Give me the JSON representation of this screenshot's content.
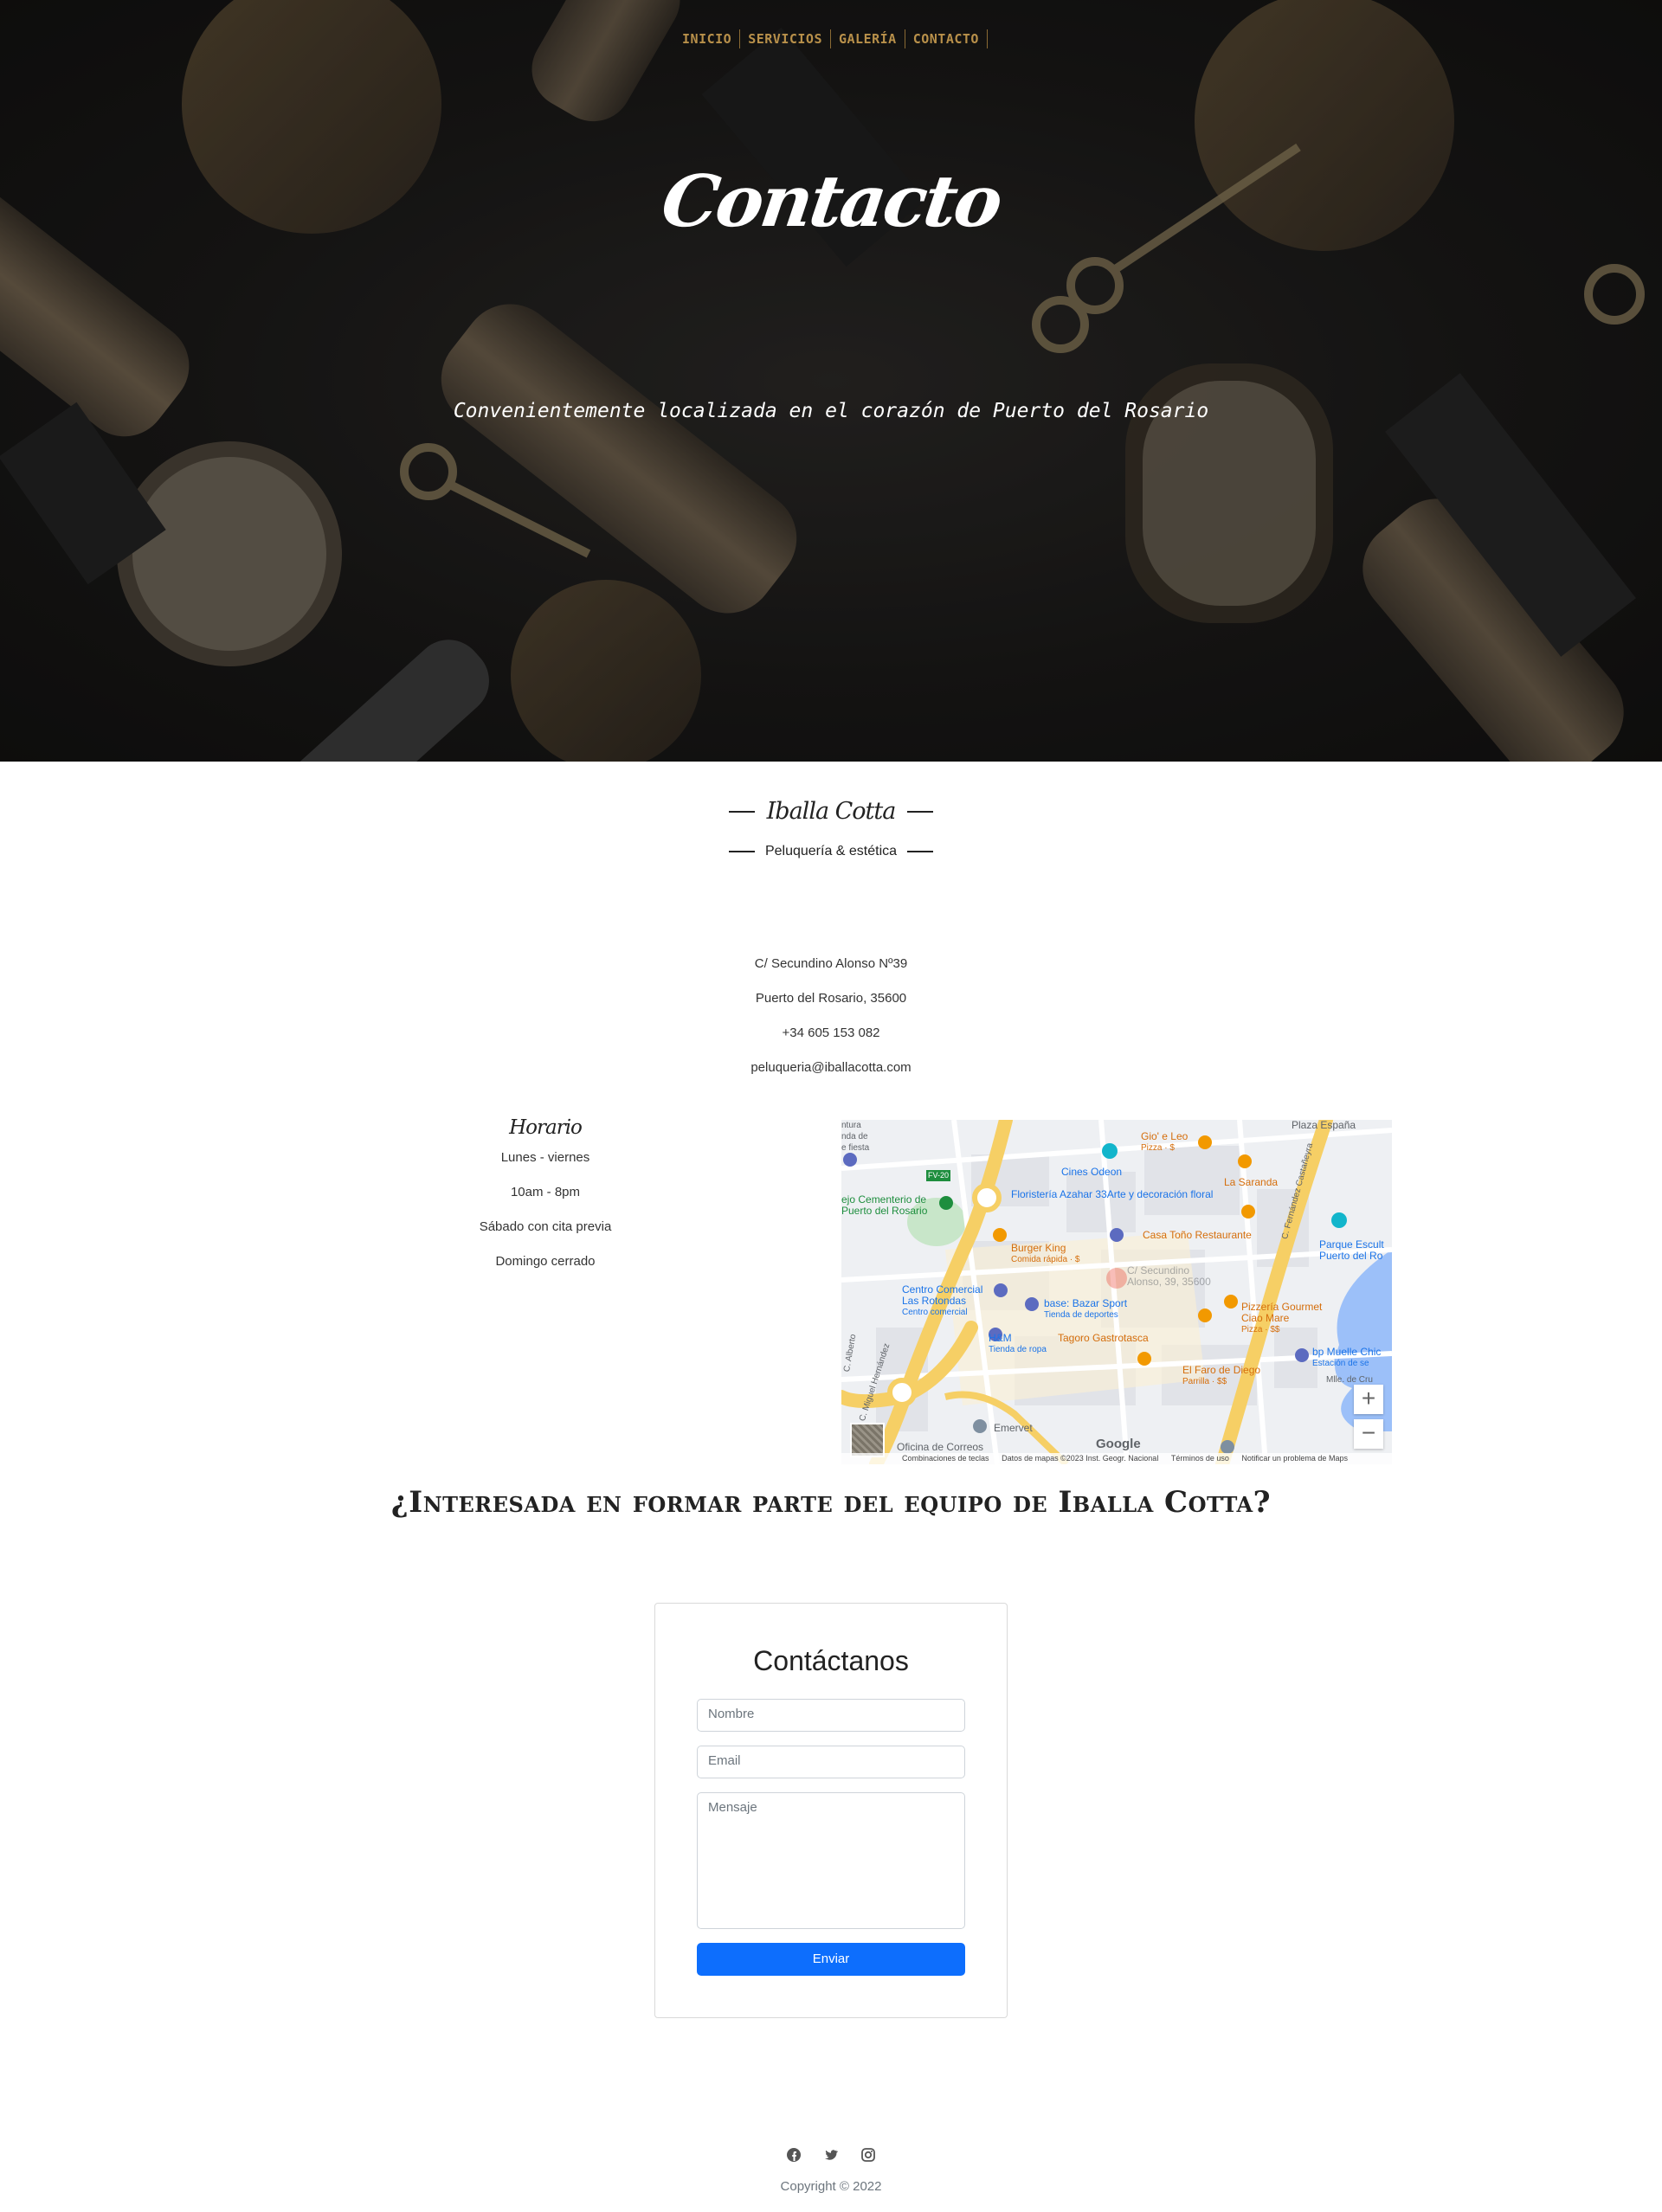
{
  "nav": {
    "items": [
      {
        "label": "INICIO"
      },
      {
        "label": "SERVICIOS"
      },
      {
        "label": "GALERÍA"
      },
      {
        "label": "CONTACTO"
      }
    ]
  },
  "hero": {
    "title": "Contacto",
    "subtitle": "Convenientemente localizada en el corazón de Puerto del Rosario"
  },
  "brand": {
    "name": "Iballa Cotta",
    "tagline": "Peluquería & estética"
  },
  "contact": {
    "address": "C/ Secundino Alonso Nº39",
    "city": "Puerto del Rosario, 35600",
    "phone": "+34 605 153 082",
    "email": "peluqueria@iballacotta.com"
  },
  "schedule": {
    "title": "Horario",
    "lines": [
      "Lunes - viernes",
      "10am - 8pm",
      "Sábado con cita previa",
      "Domingo cerrado"
    ]
  },
  "map": {
    "labels": {
      "plaza": "Plaza España",
      "gio": "Gio' e Leo",
      "gio_sub": "Pizza · $",
      "cines": "Cines Odeon",
      "saranda": "La Saranda",
      "floristeria": "Floristería Azahar 33",
      "floristeria_2": "Arte y decoración floral",
      "floristeria_sub": "Floristería",
      "cementerio": "ejo Cementerio de",
      "cementerio_2": "Puerto del Rosario",
      "casa": "Casa Toño Restaurante",
      "parque": "Parque Escult",
      "parque_2": "Puerto del Ro",
      "burger": "Burger King",
      "burger_sub": "Comida rápida · $",
      "target": "C/ Secundino",
      "target_2": "Alonso, 39, 35600",
      "centro": "Centro Comercial",
      "centro_2": "Las Rotondas",
      "centro_sub": "Centro comercial",
      "bazar": "base: Bazar Sport",
      "bazar_sub": "Tienda de deportes",
      "pizzeria": "Pizzería Gourmet",
      "pizzeria_2": "Ciao Mare",
      "pizzeria_sub": "Pizza · $$",
      "hm": "H&M",
      "hm_sub": "Tienda de ropa",
      "tagoro": "Tagoro Gastrotasca",
      "faro": "El Faro de Diego",
      "faro_sub": "Parrilla · $$",
      "muelle": "bp Muelle Chic",
      "muelle_sub": "Estación de se",
      "mlle": "Mlle. de Cru",
      "emervet": "Emervet",
      "correos": "Oficina de Correos",
      "fv": "FV-20",
      "miguel": "C. Miguel Hernández",
      "alberto": "C. Alberto",
      "fernandez": "C. Fernández Castañeyra",
      "fiesta": "ntura",
      "fiesta_2": "nda de",
      "fiesta_3": "e fiesta"
    },
    "zoom_in": "+",
    "zoom_out": "−",
    "google": "Google",
    "attribution": [
      "Combinaciones de teclas",
      "Datos de mapas ©2023 Inst. Geogr. Nacional",
      "Términos de uso",
      "Notificar un problema de Maps"
    ]
  },
  "join": {
    "title": "¿Interesada en formar parte del equipo de Iballa Cotta?"
  },
  "form": {
    "title": "Contáctanos",
    "name_placeholder": "Nombre",
    "email_placeholder": "Email",
    "message_placeholder": "Mensaje",
    "submit_label": "Enviar"
  },
  "social": {
    "icons": [
      "facebook-icon",
      "twitter-icon",
      "instagram-icon"
    ]
  },
  "footer": {
    "copyright": "Copyright © 2022"
  },
  "colors": {
    "nav_gold": "#b8904a",
    "button_blue": "#0d6efd",
    "hero_dark": "#1a1918"
  }
}
